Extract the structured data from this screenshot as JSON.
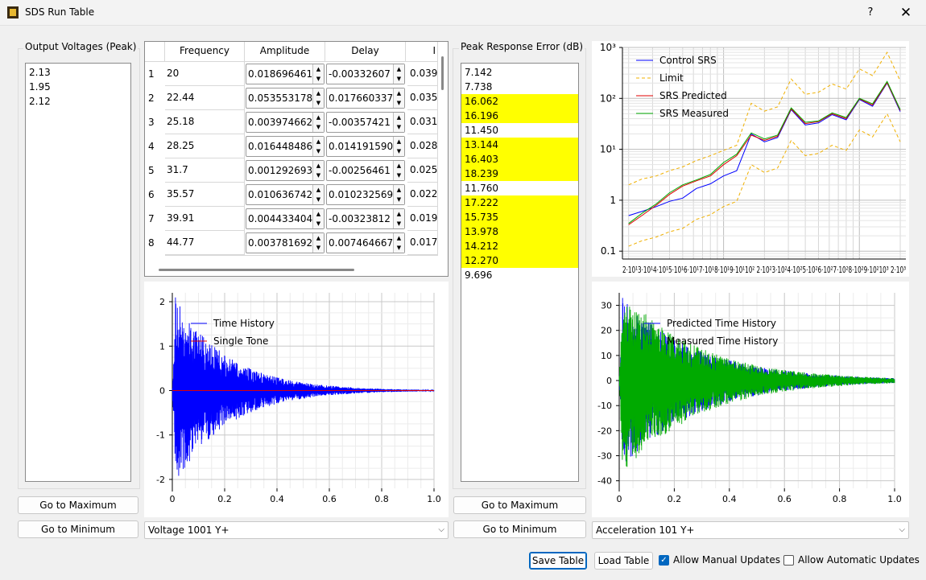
{
  "window": {
    "title": "SDS Run Table",
    "help": "?",
    "close": "✕"
  },
  "output_voltages": {
    "title": "Output Voltages (Peak)",
    "items": [
      "2.13",
      "1.95",
      "2.12"
    ],
    "go_max": "Go to Maximum",
    "go_min": "Go to Minimum"
  },
  "table": {
    "headers": [
      "Frequency",
      "Amplitude",
      "Delay",
      "I"
    ],
    "rows": [
      {
        "n": "1",
        "freq": "20",
        "amp": "0.018696461",
        "delay": "-0.00332607",
        "extra": "0.039"
      },
      {
        "n": "2",
        "freq": "22.44",
        "amp": "0.053553178",
        "delay": "0.017660337",
        "extra": "0.035"
      },
      {
        "n": "3",
        "freq": "25.18",
        "amp": "0.003974662",
        "delay": "-0.00357421",
        "extra": "0.031"
      },
      {
        "n": "4",
        "freq": "28.25",
        "amp": "0.016448486",
        "delay": "0.014191590",
        "extra": "0.028"
      },
      {
        "n": "5",
        "freq": "31.7",
        "amp": "0.001292693",
        "delay": "-0.00256461",
        "extra": "0.025"
      },
      {
        "n": "6",
        "freq": "35.57",
        "amp": "0.010636742",
        "delay": "0.010232569",
        "extra": "0.022"
      },
      {
        "n": "7",
        "freq": "39.91",
        "amp": "0.004433404",
        "delay": "-0.00323812",
        "extra": "0.019"
      },
      {
        "n": "8",
        "freq": "44.77",
        "amp": "0.003781692",
        "delay": "0.007464667",
        "extra": "0.017"
      }
    ]
  },
  "voltage_combo": "Voltage 1001 Y+",
  "peak_error": {
    "title": "Peak Response Error (dB)",
    "items": [
      {
        "v": "7.142",
        "hl": false
      },
      {
        "v": "7.738",
        "hl": false
      },
      {
        "v": "16.062",
        "hl": true
      },
      {
        "v": "16.196",
        "hl": true
      },
      {
        "v": "11.450",
        "hl": false
      },
      {
        "v": "13.144",
        "hl": true
      },
      {
        "v": "16.403",
        "hl": true
      },
      {
        "v": "18.239",
        "hl": true
      },
      {
        "v": "11.760",
        "hl": false
      },
      {
        "v": "17.222",
        "hl": true
      },
      {
        "v": "15.735",
        "hl": true
      },
      {
        "v": "13.978",
        "hl": true
      },
      {
        "v": "14.212",
        "hl": true
      },
      {
        "v": "12.270",
        "hl": true
      },
      {
        "v": "9.696",
        "hl": false
      }
    ],
    "go_max": "Go to Maximum",
    "go_min": "Go to Minimum"
  },
  "accel_combo": "Acceleration 101 Y+",
  "footer": {
    "save": "Save Table",
    "load": "Load Table",
    "manual": "Allow Manual Updates",
    "manual_checked": true,
    "automatic": "Allow Automatic Updates",
    "automatic_checked": false
  },
  "colors": {
    "highlight": "#ffff00",
    "blue": "#0000ff",
    "red": "#e00000",
    "green": "#00aa00",
    "orange": "#f0b000"
  },
  "chart_data": [
    {
      "type": "line",
      "name": "voltage-time-history",
      "legend": [
        "Time History",
        "Single Tone"
      ],
      "xlim": [
        0,
        1.0
      ],
      "ylim": [
        -2.2,
        2.2
      ],
      "xticks": [
        "0",
        "0.2",
        "0.4",
        "0.6",
        "0.8",
        "1.0"
      ],
      "yticks": [
        "2",
        "1",
        "0",
        "-1",
        "-2"
      ],
      "series": [
        {
          "name": "Time History",
          "color": "#0000ff",
          "kind": "decaying oscillation",
          "peak": 2.1,
          "decay_end": 0.55
        },
        {
          "name": "Single Tone",
          "color": "#e00000",
          "kind": "flat",
          "value": 0
        }
      ]
    },
    {
      "type": "line",
      "name": "srs",
      "xscale": "log",
      "yscale": "log",
      "xlim": [
        18,
        2200
      ],
      "ylim": [
        0.07,
        1000
      ],
      "yticks": [
        "10³",
        "10²",
        "10¹",
        "1",
        "0.1"
      ],
      "xtick_text": "2·10¹3·10¹4·10¹5·10¹6·10¹7·10¹8·10¹9·10¹10² 2·10²3·10²4·10²5·10²6·10²7·10²8·10²9·10²10³ 2·10³",
      "legend": [
        "Control SRS",
        "Limit",
        "SRS Predicted",
        "SRS Measured"
      ],
      "x": [
        20,
        25,
        32,
        40,
        50,
        63,
        80,
        100,
        125,
        160,
        200,
        250,
        315,
        400,
        500,
        630,
        800,
        1000,
        1250,
        1600,
        2000
      ],
      "series": [
        {
          "name": "Control SRS",
          "color": "#0000ff",
          "values": [
            0.5,
            0.6,
            0.75,
            0.95,
            1.1,
            1.7,
            2.1,
            3.0,
            3.8,
            20,
            14,
            17,
            60,
            30,
            33,
            48,
            38,
            95,
            70,
            200,
            55
          ]
        },
        {
          "name": "Limit",
          "color": "#f0b000",
          "style": "dashed",
          "upper": [
            2.0,
            2.6,
            3.0,
            3.8,
            4.5,
            6,
            7.5,
            9.5,
            12,
            80,
            56,
            68,
            240,
            120,
            132,
            192,
            152,
            380,
            280,
            800,
            220
          ],
          "lower": [
            0.125,
            0.16,
            0.19,
            0.24,
            0.28,
            0.42,
            0.52,
            0.75,
            0.95,
            5,
            3.5,
            4.3,
            15,
            7.5,
            8.3,
            12,
            9.5,
            24,
            17.5,
            50,
            14
          ]
        },
        {
          "name": "SRS Predicted",
          "color": "#e00000",
          "values": [
            0.33,
            0.5,
            0.8,
            1.3,
            1.9,
            2.4,
            3.0,
            5.0,
            7.5,
            19,
            15,
            18,
            62,
            32,
            35,
            50,
            40,
            98,
            74,
            205,
            58
          ]
        },
        {
          "name": "SRS Measured",
          "color": "#00aa00",
          "values": [
            0.35,
            0.55,
            0.85,
            1.4,
            2.0,
            2.5,
            3.2,
            5.5,
            8.0,
            21,
            16,
            19,
            65,
            34,
            36,
            52,
            42,
            100,
            78,
            215,
            60
          ]
        }
      ]
    },
    {
      "type": "line",
      "name": "acceleration-time-history",
      "legend": [
        "Predicted Time History",
        "Measured Time History"
      ],
      "xlim": [
        0,
        1.0
      ],
      "ylim": [
        -43,
        35
      ],
      "xticks": [
        "0",
        "0.2",
        "0.4",
        "0.6",
        "0.8",
        "1.0"
      ],
      "yticks": [
        "30",
        "20",
        "10",
        "0",
        "-10",
        "-20",
        "-30",
        "-40"
      ],
      "series": [
        {
          "name": "Predicted Time History",
          "color": "#0000ff",
          "kind": "decaying oscillation",
          "peak": 33
        },
        {
          "name": "Measured Time History",
          "color": "#00aa00",
          "kind": "decaying oscillation",
          "peak": 36
        }
      ]
    }
  ]
}
